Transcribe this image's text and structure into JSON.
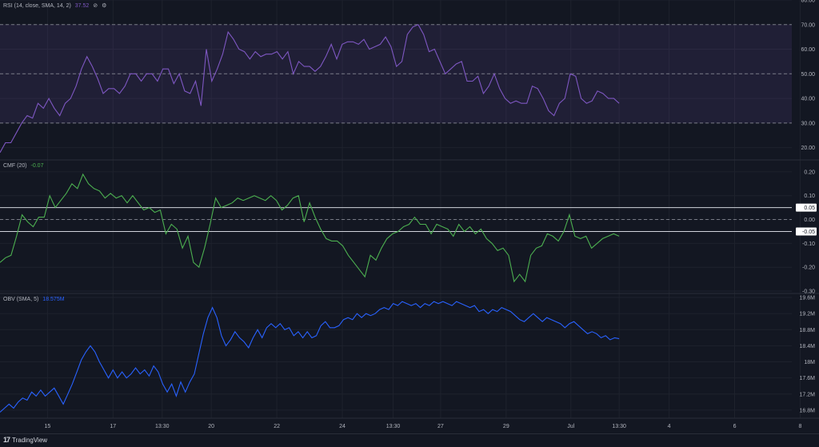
{
  "colors": {
    "background": "#131722",
    "grid": "#1e222d",
    "axis_text": "#b2b5be",
    "rsi_line": "#7e57c2",
    "rsi_band": "#7e57c2",
    "cmf_line": "#4caf50",
    "obv_line": "#2962ff",
    "level_line": "#d1d4dc",
    "label_bg": "#ffffff"
  },
  "footer": {
    "brand": "TradingView",
    "logo": "17"
  },
  "chart_data": [
    {
      "type": "line",
      "title": "RSI (14, close, SMA, 14, 2)",
      "current_value": "37.52",
      "icons": [
        "eye-slash-icon",
        "gear-icon"
      ],
      "ylim": [
        15,
        80
      ],
      "yticks": [
        {
          "v": 80,
          "label": "80.00"
        },
        {
          "v": 70,
          "label": "70.00"
        },
        {
          "v": 60,
          "label": "60.00"
        },
        {
          "v": 50,
          "label": "50.00"
        },
        {
          "v": 40,
          "label": "40.00"
        },
        {
          "v": 30,
          "label": "30.00"
        },
        {
          "v": 20,
          "label": "20.00"
        }
      ],
      "band": [
        30,
        70
      ],
      "dashed_levels": [
        30,
        50,
        70
      ],
      "series": [
        {
          "values": [
            18,
            22,
            22,
            26,
            30,
            33,
            32,
            38,
            36,
            40,
            36,
            33,
            38,
            40,
            45,
            52,
            57,
            53,
            48,
            42,
            44,
            44,
            42,
            45,
            50,
            50,
            47,
            50,
            50,
            47,
            52,
            52,
            46,
            50,
            43,
            42,
            47,
            37,
            60,
            47,
            52,
            58,
            67,
            64,
            60,
            59,
            56,
            59,
            57,
            58,
            58,
            59,
            56,
            59,
            50,
            55,
            53,
            53,
            51,
            53,
            57,
            62,
            56,
            62,
            63,
            63,
            62,
            64,
            60,
            61,
            62,
            65,
            61,
            53,
            55,
            66,
            69,
            70,
            66,
            59,
            60,
            55,
            50,
            52,
            54,
            55,
            47,
            47,
            49,
            42,
            45,
            50,
            44,
            40,
            38,
            39,
            38,
            38,
            45,
            44,
            40,
            35,
            33,
            38,
            40,
            50,
            49,
            40,
            38,
            39,
            43,
            42,
            40,
            40,
            38
          ],
          "color": "#7e57c2"
        }
      ]
    },
    {
      "type": "line",
      "title": "CMF (20)",
      "current_value": "-0.07",
      "ylim": [
        -0.31,
        0.25
      ],
      "yticks": [
        {
          "v": 0.2,
          "label": "0.20"
        },
        {
          "v": 0.1,
          "label": "0.10"
        },
        {
          "v": 0.0,
          "label": "0.00"
        },
        {
          "v": -0.1,
          "label": "-0.10"
        },
        {
          "v": -0.2,
          "label": "-0.20"
        },
        {
          "v": -0.3,
          "label": "-0.30"
        }
      ],
      "dashed_levels": [
        0
      ],
      "levels": [
        {
          "v": 0.05,
          "label": "0.05"
        },
        {
          "v": -0.05,
          "label": "-0.05"
        }
      ],
      "series": [
        {
          "values": [
            -0.18,
            -0.16,
            -0.15,
            -0.07,
            0.02,
            -0.01,
            -0.03,
            0.01,
            0.01,
            0.1,
            0.05,
            0.08,
            0.11,
            0.15,
            0.13,
            0.19,
            0.15,
            0.13,
            0.12,
            0.09,
            0.11,
            0.09,
            0.1,
            0.07,
            0.1,
            0.07,
            0.04,
            0.05,
            0.03,
            0.04,
            -0.06,
            -0.02,
            -0.04,
            -0.12,
            -0.07,
            -0.18,
            -0.2,
            -0.12,
            -0.02,
            0.09,
            0.05,
            0.06,
            0.07,
            0.09,
            0.08,
            0.09,
            0.1,
            0.09,
            0.08,
            0.1,
            0.08,
            0.04,
            0.06,
            0.09,
            0.1,
            -0.01,
            0.07,
            0.01,
            -0.04,
            -0.08,
            -0.09,
            -0.09,
            -0.11,
            -0.15,
            -0.18,
            -0.21,
            -0.24,
            -0.15,
            -0.17,
            -0.12,
            -0.08,
            -0.06,
            -0.05,
            -0.03,
            -0.02,
            0.01,
            -0.02,
            -0.02,
            -0.06,
            -0.02,
            -0.03,
            -0.04,
            -0.07,
            -0.02,
            -0.05,
            -0.03,
            -0.06,
            -0.04,
            -0.08,
            -0.1,
            -0.13,
            -0.12,
            -0.15,
            -0.26,
            -0.23,
            -0.26,
            -0.15,
            -0.12,
            -0.11,
            -0.06,
            -0.07,
            -0.09,
            -0.05,
            0.02,
            -0.07,
            -0.08,
            -0.07,
            -0.12,
            -0.1,
            -0.08,
            -0.07,
            -0.06,
            -0.07
          ],
          "color": "#4caf50"
        }
      ]
    },
    {
      "type": "line",
      "title": "OBV (SMA, 5)",
      "current_value": "18.575M",
      "ylim": [
        16.6,
        19.7
      ],
      "yticks": [
        {
          "v": 19.6,
          "label": "19.6M"
        },
        {
          "v": 19.2,
          "label": "19.2M"
        },
        {
          "v": 18.8,
          "label": "18.8M"
        },
        {
          "v": 18.4,
          "label": "18.4M"
        },
        {
          "v": 18.0,
          "label": "18M"
        },
        {
          "v": 17.6,
          "label": "17.6M"
        },
        {
          "v": 17.2,
          "label": "17.2M"
        },
        {
          "v": 16.8,
          "label": "16.8M"
        }
      ],
      "series": [
        {
          "values": [
            16.75,
            16.85,
            16.95,
            16.85,
            17.0,
            17.1,
            17.05,
            17.25,
            17.15,
            17.3,
            17.15,
            17.25,
            17.35,
            17.15,
            16.95,
            17.2,
            17.45,
            17.75,
            18.05,
            18.25,
            18.4,
            18.25,
            18.0,
            17.8,
            17.6,
            17.8,
            17.6,
            17.75,
            17.6,
            17.7,
            17.85,
            17.7,
            17.8,
            17.65,
            17.9,
            17.75,
            17.45,
            17.25,
            17.45,
            17.15,
            17.5,
            17.25,
            17.5,
            17.7,
            18.2,
            18.7,
            19.1,
            19.35,
            19.1,
            18.65,
            18.4,
            18.55,
            18.75,
            18.6,
            18.5,
            18.35,
            18.6,
            18.8,
            18.6,
            18.85,
            18.95,
            18.85,
            18.95,
            18.8,
            18.85,
            18.65,
            18.75,
            18.6,
            18.75,
            18.6,
            18.65,
            18.9,
            19.0,
            18.85,
            18.85,
            18.9,
            19.05,
            19.1,
            19.05,
            19.2,
            19.1,
            19.2,
            19.15,
            19.2,
            19.3,
            19.35,
            19.3,
            19.45,
            19.4,
            19.5,
            19.45,
            19.4,
            19.45,
            19.35,
            19.45,
            19.4,
            19.5,
            19.45,
            19.5,
            19.45,
            19.4,
            19.5,
            19.45,
            19.4,
            19.35,
            19.4,
            19.25,
            19.3,
            19.2,
            19.3,
            19.25,
            19.35,
            19.3,
            19.25,
            19.15,
            19.05,
            19.0,
            19.1,
            19.2,
            19.1,
            19.0,
            19.1,
            19.05,
            19.0,
            18.95,
            18.85,
            18.95,
            19.0,
            18.9,
            18.8,
            18.7,
            18.75,
            18.7,
            18.6,
            18.65,
            18.55,
            18.6,
            18.575
          ],
          "color": "#2962ff"
        }
      ]
    }
  ],
  "x_axis": {
    "ticks": [
      {
        "label": "15",
        "frac": 0.058
      },
      {
        "label": "17",
        "frac": 0.138
      },
      {
        "label": "13:30",
        "frac": 0.198
      },
      {
        "label": "20",
        "frac": 0.258
      },
      {
        "label": "22",
        "frac": 0.338
      },
      {
        "label": "24",
        "frac": 0.418
      },
      {
        "label": "13:30",
        "frac": 0.48
      },
      {
        "label": "27",
        "frac": 0.538
      },
      {
        "label": "29",
        "frac": 0.618
      },
      {
        "label": "Jul",
        "frac": 0.697
      },
      {
        "label": "13:30",
        "frac": 0.756
      },
      {
        "label": "4",
        "frac": 0.817
      },
      {
        "label": "6",
        "frac": 0.897
      },
      {
        "label": "8",
        "frac": 0.977
      }
    ],
    "data_end_frac": 0.756
  }
}
